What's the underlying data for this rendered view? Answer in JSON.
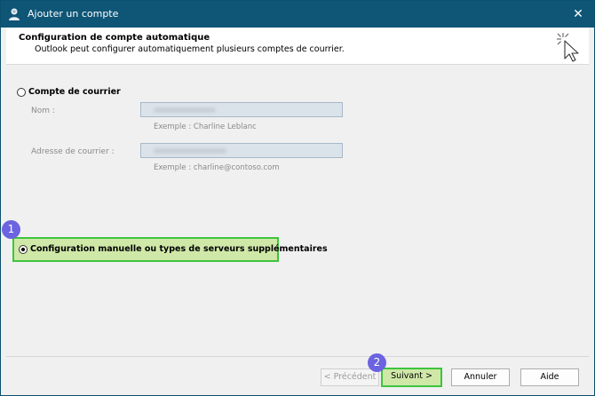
{
  "window": {
    "title": "Ajouter un compte",
    "close_glyph": "✕"
  },
  "header": {
    "title": "Configuration de compte automatique",
    "subtitle": "Outlook peut configurer automatiquement plusieurs comptes de courrier."
  },
  "options": {
    "auto": {
      "label": "Compte de courrier",
      "selected": false
    },
    "manual": {
      "label": "Configuration manuelle ou types de serveurs supplémentaires",
      "selected": true
    }
  },
  "fields": {
    "name": {
      "label": "Nom :",
      "value": "",
      "example": "Exemple : Charline Leblanc"
    },
    "email": {
      "label": "Adresse de courrier :",
      "value": "",
      "example": "Exemple : charline@contoso.com"
    }
  },
  "badges": {
    "step1": "1",
    "step2": "2"
  },
  "buttons": {
    "back": "< Précédent",
    "next": "Suivant >",
    "cancel": "Annuler",
    "help": "Aide"
  },
  "colors": {
    "titlebar": "#0e5576",
    "highlight_fill": "#cfe8a8",
    "highlight_border": "#3ec43e",
    "badge": "#6b63e0"
  }
}
